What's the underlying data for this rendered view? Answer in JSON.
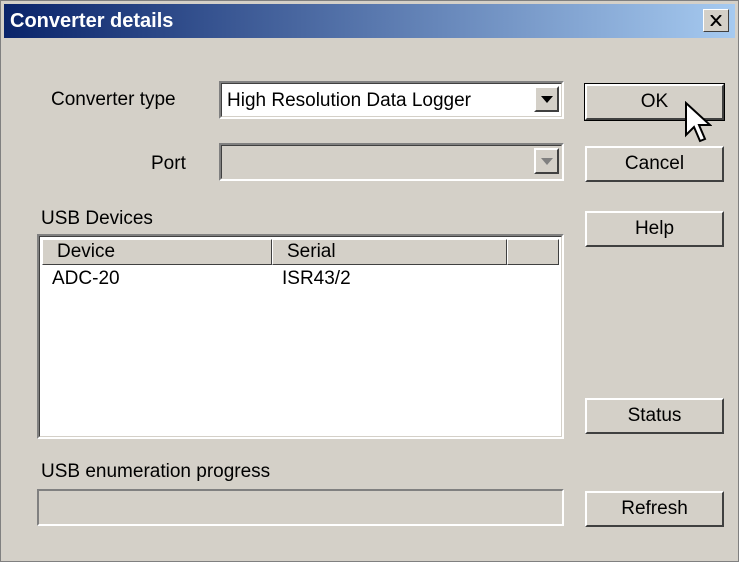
{
  "window": {
    "title": "Converter details"
  },
  "form": {
    "converter_type_label": "Converter type",
    "converter_type_value": "High Resolution Data Logger",
    "port_label": "Port",
    "port_value": "",
    "usb_devices_label": "USB Devices",
    "progress_label": "USB enumeration progress",
    "progress_fraction": 0
  },
  "table": {
    "columns": [
      "Device",
      "Serial",
      ""
    ],
    "rows": [
      {
        "device": "ADC-20",
        "serial": "ISR43/2"
      }
    ]
  },
  "buttons": {
    "ok": "OK",
    "cancel": "Cancel",
    "help": "Help",
    "status": "Status",
    "refresh": "Refresh"
  },
  "icons": [
    "close-icon",
    "chevron-down-icon",
    "mouse-pointer-icon"
  ]
}
